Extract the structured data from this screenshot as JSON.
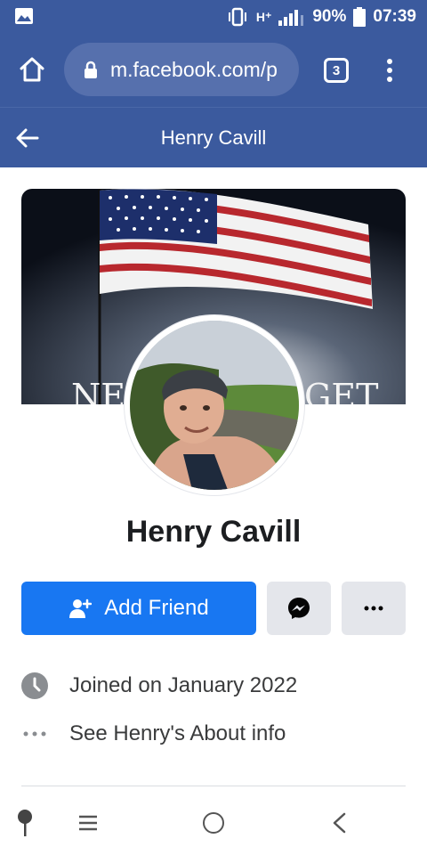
{
  "status_bar": {
    "network": "H⁺",
    "battery": "90%",
    "time": "07:39"
  },
  "browser": {
    "url": "m.facebook.com/p",
    "tab_count": "3",
    "icons": [
      "home-icon",
      "lock-icon",
      "tabs-icon",
      "more-vert-icon"
    ]
  },
  "header": {
    "title": "Henry Cavill"
  },
  "profile": {
    "name": "Henry Cavill",
    "cover_text_left": "NE",
    "cover_text_right": "GET"
  },
  "actions": {
    "add_friend_label": "Add Friend"
  },
  "info": {
    "joined": "Joined on January 2022",
    "about": "See Henry's About info"
  },
  "colors": {
    "header_blue": "#3b5a9e",
    "button_blue": "#1877f2",
    "secondary_button": "#e4e6eb",
    "text_dark": "#1c1e21"
  }
}
